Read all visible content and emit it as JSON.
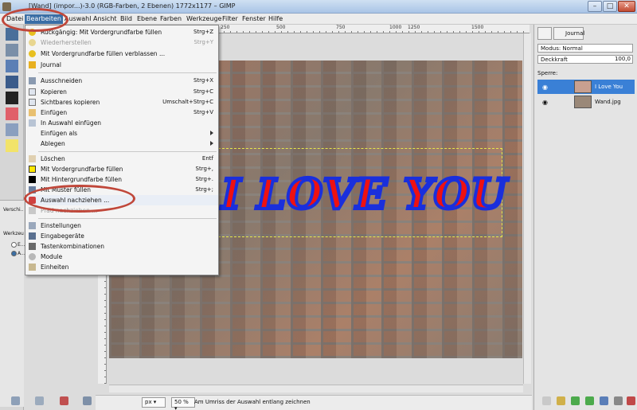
{
  "window": {
    "title": "[Wand] (impor...)-3.0 (RGB-Farben, 2 Ebenen) 1772x1177 – GIMP",
    "minimize": "–",
    "maximize": "□",
    "close": "✕"
  },
  "menubar": [
    "Datei",
    "Bearbeiten",
    "Auswahl",
    "Ansicht",
    "Bild",
    "Ebene",
    "Farben",
    "Werkzeuge",
    "Filter",
    "Fenster",
    "Hilfe"
  ],
  "edit_menu": {
    "items": [
      {
        "label": "Rückgängig: Mit Vordergrundfarbe füllen",
        "shortcut": "Strg+Z",
        "disabled": false
      },
      {
        "label": "Wiederherstellen",
        "shortcut": "Strg+Y",
        "disabled": true
      },
      {
        "label": "Mit Vordergrundfarbe füllen verblassen ...",
        "shortcut": "",
        "disabled": false
      },
      {
        "label": "Journal",
        "shortcut": "",
        "disabled": false
      },
      {
        "label": "Ausschneiden",
        "shortcut": "Strg+X",
        "disabled": false
      },
      {
        "label": "Kopieren",
        "shortcut": "Strg+C",
        "disabled": false
      },
      {
        "label": "Sichtbares kopieren",
        "shortcut": "Umschalt+Strg+C",
        "disabled": false
      },
      {
        "label": "Einfügen",
        "shortcut": "Strg+V",
        "disabled": false
      },
      {
        "label": "In Auswahl einfügen",
        "shortcut": "",
        "disabled": false
      },
      {
        "label": "Einfügen als",
        "shortcut": "",
        "disabled": false
      },
      {
        "label": "Ablegen",
        "shortcut": "",
        "disabled": false
      },
      {
        "label": "Löschen",
        "shortcut": "Entf",
        "disabled": false
      },
      {
        "label": "Mit Vordergrundfarbe füllen",
        "shortcut": "Strg+,",
        "disabled": false
      },
      {
        "label": "Mit Hintergrundfarbe füllen",
        "shortcut": "Strg+.",
        "disabled": false
      },
      {
        "label": "Mit Muster füllen",
        "shortcut": "Strg+;",
        "disabled": false
      },
      {
        "label": "Auswahl nachziehen ...",
        "shortcut": "",
        "disabled": false
      },
      {
        "label": "Pfad nachziehen ...",
        "shortcut": "",
        "disabled": true
      },
      {
        "label": "Einstellungen",
        "shortcut": "",
        "disabled": false
      },
      {
        "label": "Eingabegeräte",
        "shortcut": "",
        "disabled": false
      },
      {
        "label": "Tastenkombinationen",
        "shortcut": "",
        "disabled": false
      },
      {
        "label": "Module",
        "shortcut": "",
        "disabled": false
      },
      {
        "label": "Einheiten",
        "shortcut": "",
        "disabled": false
      }
    ]
  },
  "ruler": {
    "labels": [
      "250",
      "500",
      "750",
      "1000",
      "1250",
      "1500"
    ]
  },
  "canvas": {
    "text": "I LOVE YOU"
  },
  "toolbox": {
    "options_title": "Verschi...",
    "options_label": "Werkzeu...",
    "radio1": "E...",
    "radio2": "A..."
  },
  "statusbar": {
    "unit": "px ▾",
    "zoom": "50 % ▾",
    "message": "Am Umriss der Auswahl entlang zeichnen"
  },
  "dock": {
    "tab_label": "Journal",
    "mode_label": "Modus: Normal",
    "opacity_label": "Deckkraft",
    "opacity_value": "100,0",
    "lock_label": "Sperre:",
    "layers": [
      {
        "name": "I Love You",
        "selected": true
      },
      {
        "name": "Wand.jpg",
        "selected": false
      }
    ]
  },
  "colors": {
    "menu_highlight": "#3a6ea5",
    "annotation": "#c0473a",
    "text_fill": "#e11111",
    "text_stroke": "#1a2fdc",
    "layer_selected": "#3a80d6"
  }
}
